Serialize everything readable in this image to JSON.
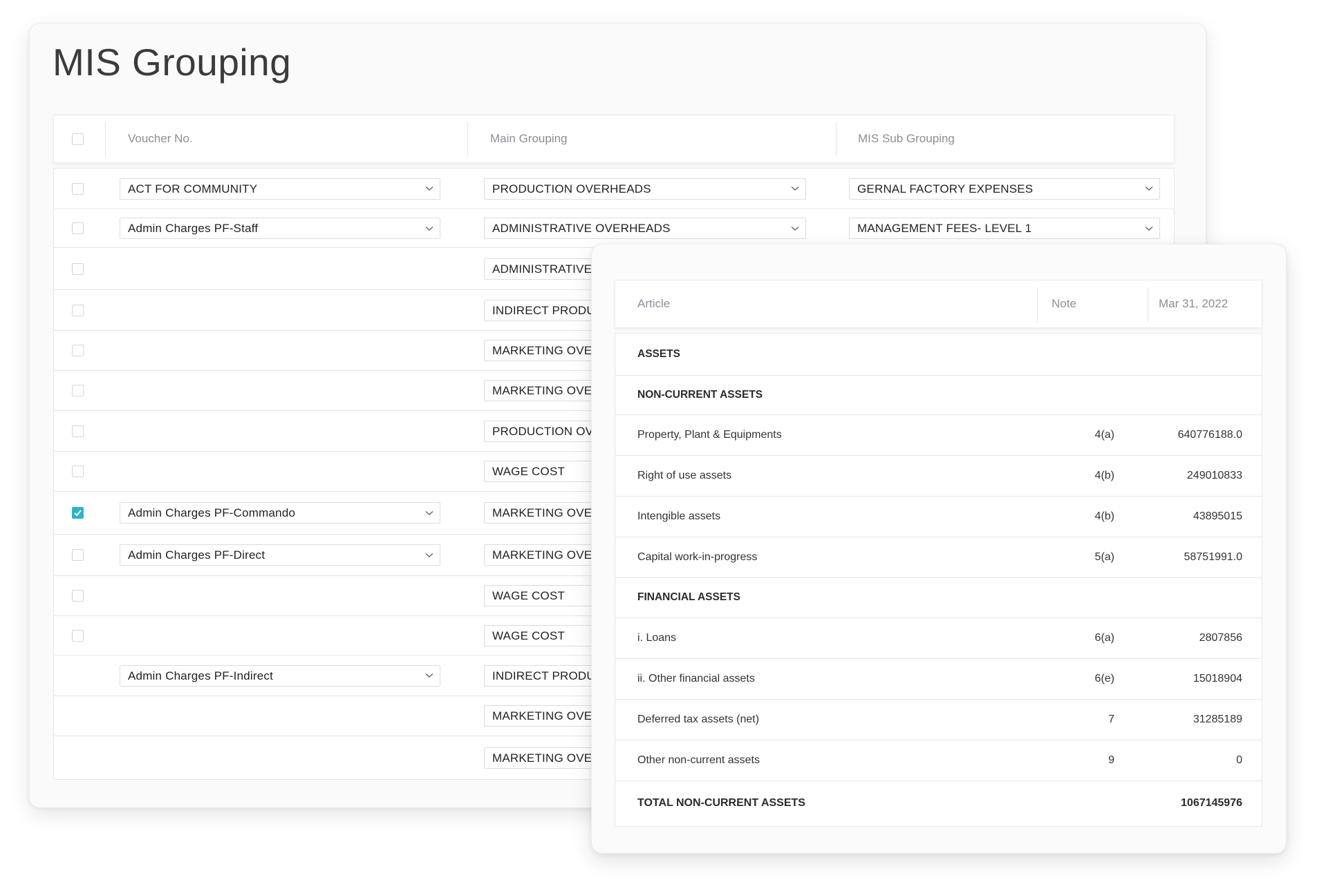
{
  "page": {
    "title": "MIS Grouping"
  },
  "grouping_table": {
    "headers": {
      "voucher": "Voucher No.",
      "main": "Main Grouping",
      "sub": "MIS Sub Grouping"
    },
    "rows": [
      {
        "checked": false,
        "voucher": "ACT FOR COMMUNITY",
        "main": "PRODUCTION OVERHEADS",
        "sub": "GERNAL FACTORY EXPENSES"
      },
      {
        "checked": false,
        "voucher": "Admin Charges PF-Staff",
        "main": "ADMINISTRATIVE OVERHEADS",
        "sub": "MANAGEMENT FEES- LEVEL 1"
      },
      {
        "checked": false,
        "voucher": "",
        "main": "ADMINISTRATIVE O",
        "sub": ""
      },
      {
        "checked": false,
        "voucher": "",
        "main": "INDIRECT PRODUC",
        "sub": ""
      },
      {
        "checked": false,
        "voucher": "",
        "main": "MARKETING OVER",
        "sub": ""
      },
      {
        "checked": false,
        "voucher": "",
        "main": "MARKETING OVER",
        "sub": ""
      },
      {
        "checked": false,
        "voucher": "",
        "main": "PRODUCTION OVE",
        "sub": ""
      },
      {
        "checked": false,
        "voucher": "",
        "main": "WAGE COST",
        "sub": ""
      },
      {
        "checked": true,
        "voucher": "Admin Charges PF-Commando",
        "main": "MARKETING OVER",
        "sub": ""
      },
      {
        "checked": false,
        "voucher": "Admin Charges PF-Direct",
        "main": "MARKETING OVER",
        "sub": ""
      },
      {
        "checked": false,
        "voucher": "",
        "main": "WAGE COST",
        "sub": ""
      },
      {
        "checked": false,
        "voucher": "",
        "main": "WAGE COST",
        "sub": ""
      },
      {
        "checked": null,
        "voucher": "Admin Charges PF-Indirect",
        "main": "INDIRECT PRODUC",
        "sub": ""
      },
      {
        "checked": null,
        "voucher": "",
        "main": "MARKETING OVER",
        "sub": ""
      },
      {
        "checked": null,
        "voucher": "",
        "main": "MARKETING OVER",
        "sub": ""
      }
    ]
  },
  "balance_table": {
    "headers": {
      "article": "Article",
      "note": "Note",
      "date": "Mar 31, 2022"
    },
    "rows": [
      {
        "type": "section",
        "article": "ASSETS",
        "note": "",
        "value": ""
      },
      {
        "type": "section",
        "article": "NON-CURRENT ASSETS",
        "note": "",
        "value": ""
      },
      {
        "type": "item",
        "article": "Property, Plant & Equipments",
        "note": "4(a)",
        "value": "640776188.0"
      },
      {
        "type": "item",
        "article": "Right of use assets",
        "note": "4(b)",
        "value": "249010833"
      },
      {
        "type": "item",
        "article": "Intengible assets",
        "note": "4(b)",
        "value": "43895015"
      },
      {
        "type": "item",
        "article": "Capital work-in-progress",
        "note": "5(a)",
        "value": "58751991.0"
      },
      {
        "type": "section",
        "article": "FINANCIAL ASSETS",
        "note": "",
        "value": ""
      },
      {
        "type": "item",
        "article": "i. Loans",
        "note": "6(a)",
        "value": "2807856"
      },
      {
        "type": "item",
        "article": "ii. Other financial assets",
        "note": "6(e)",
        "value": "15018904"
      },
      {
        "type": "item",
        "article": "Deferred tax assets (net)",
        "note": "7",
        "value": "31285189"
      },
      {
        "type": "item",
        "article": "Other non-current assets",
        "note": "9",
        "value": "0"
      },
      {
        "type": "total",
        "article": "TOTAL NON-CURRENT ASSETS",
        "note": "",
        "value": "1067145976"
      }
    ]
  },
  "colors": {
    "accent": "#2db4c9",
    "border": "#e6e6e6",
    "header_text": "#8a8e96"
  }
}
